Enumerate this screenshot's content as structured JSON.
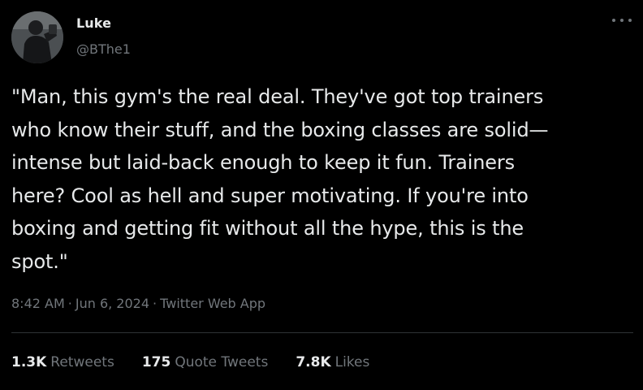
{
  "author": {
    "display_name": "Luke",
    "handle": "@BThe1"
  },
  "tweet": {
    "text": "\"Man, this gym's the real deal. They've got top trainers\nwho know their stuff, and the boxing classes are solid—\nintense but laid-back enough to keep it fun. Trainers\nhere? Cool as hell and super motivating. If you're into\nboxing and getting fit without all the hype, this is the\nspot.\""
  },
  "meta": {
    "time": "8:42 AM",
    "sep1": "·",
    "date": "Jun 6, 2024",
    "sep2": "·",
    "source": "Twitter Web App"
  },
  "stats": {
    "retweets": {
      "count": "1.3K",
      "label": "Retweets"
    },
    "quote_tweets": {
      "count": "175",
      "label": "Quote Tweets"
    },
    "likes": {
      "count": "7.8K",
      "label": "Likes"
    }
  },
  "icons": {
    "more": "more-horizontal-icon",
    "avatar": "profile-photo"
  },
  "colors": {
    "background": "#000000",
    "primary_text": "#e7e9ea",
    "secondary_text": "#71767b",
    "divider": "#2f3336"
  }
}
